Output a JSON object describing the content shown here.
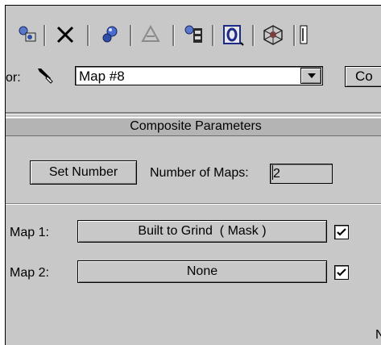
{
  "toolbar": {
    "icons": [
      "get-material-icon",
      "delete-icon",
      "assign-material-icon",
      "show-map-in-viewport-icon",
      "put-to-library-icon",
      "material-id-channel-icon",
      "show-end-result-icon",
      "go-to-parent-icon"
    ],
    "channel_value": "0"
  },
  "material": {
    "label_fragment": "or:",
    "name": "Map #8",
    "type_button_label": "Co"
  },
  "rollout": {
    "title": "Composite Parameters",
    "set_number_label": "Set Number",
    "number_of_maps_label": "Number of Maps:",
    "number_of_maps_value": "2"
  },
  "maps": [
    {
      "label": "Map 1:",
      "value": "Built to Grind  ( Mask )",
      "enabled": true
    },
    {
      "label": "Map 2:",
      "value": "None",
      "enabled": true
    }
  ],
  "footer": {
    "cut_text": "N"
  }
}
